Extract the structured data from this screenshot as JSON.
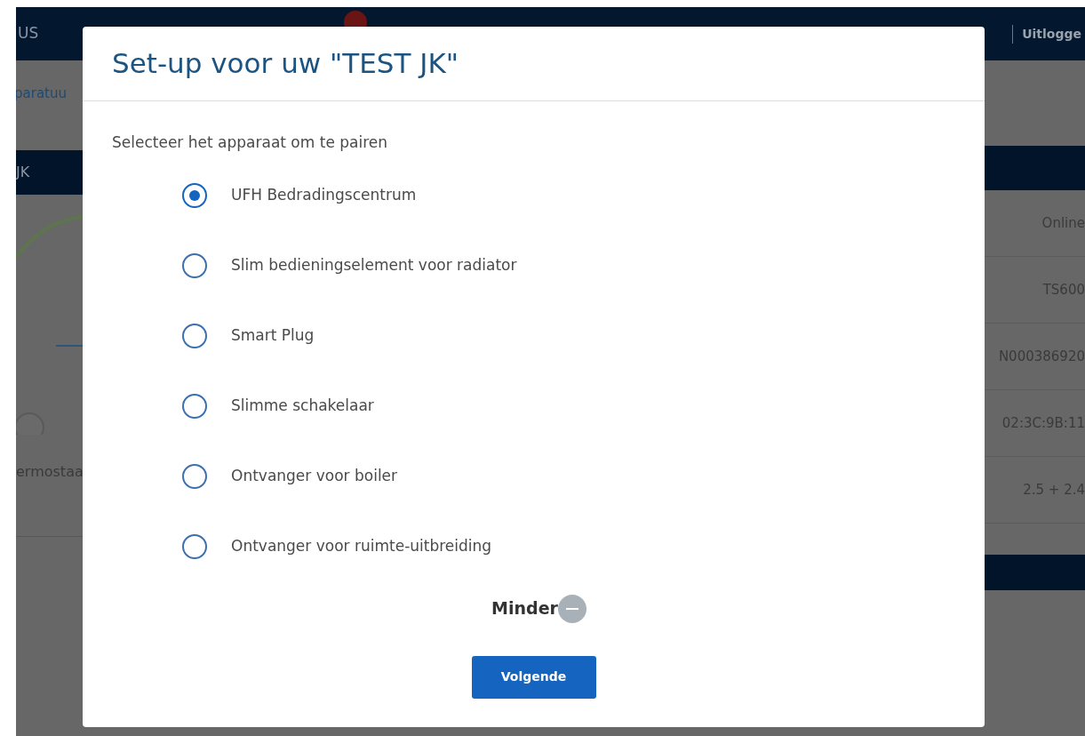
{
  "background": {
    "brand": "US",
    "logout": "Uitlogge",
    "breadcrumb": "paratuu",
    "panel_title": "JK",
    "device_label": "ermostaa",
    "details": [
      "Online",
      "TS600",
      "N000386920",
      "02:3C:9B:11",
      "2.5 + 2.4"
    ]
  },
  "dialog": {
    "title": "Set-up voor uw \"TEST JK\"",
    "prompt": "Selecteer het apparaat om te pairen",
    "options": [
      {
        "label": "UFH Bedradingscentrum",
        "selected": true
      },
      {
        "label": "Slim bedieningselement voor radiator",
        "selected": false
      },
      {
        "label": "Smart Plug",
        "selected": false
      },
      {
        "label": "Slimme schakelaar",
        "selected": false
      },
      {
        "label": "Ontvanger voor boiler",
        "selected": false
      },
      {
        "label": "Ontvanger voor ruimte-uitbreiding",
        "selected": false
      }
    ],
    "less": "Minder",
    "next": "Volgende"
  }
}
